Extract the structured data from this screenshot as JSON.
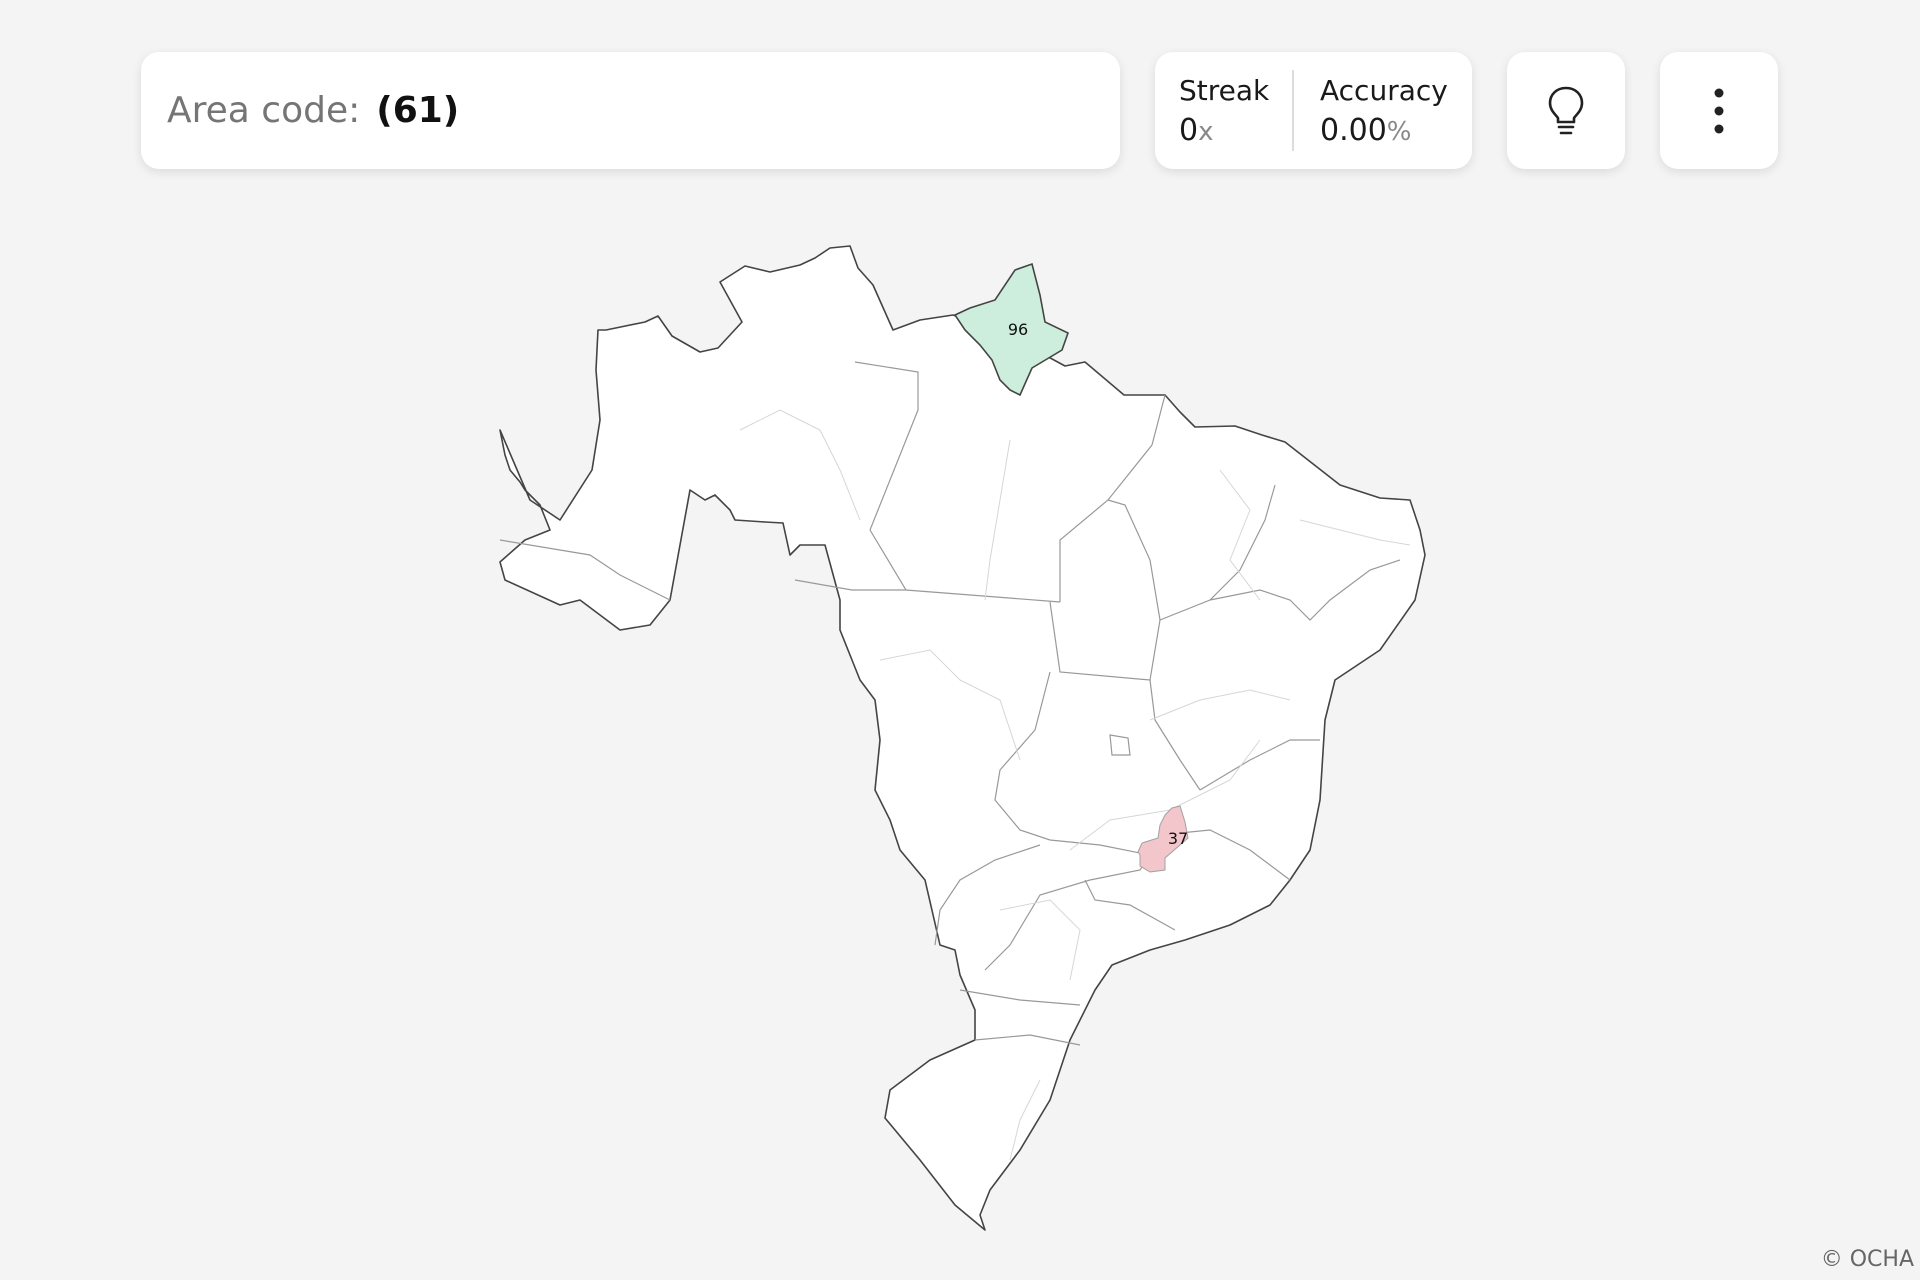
{
  "prompt": {
    "label": "Area code:",
    "value": "(61)"
  },
  "stats": {
    "streak_label": "Streak",
    "streak_value": "0",
    "streak_unit": "x",
    "accuracy_label": "Accuracy",
    "accuracy_value": "0.00",
    "accuracy_unit": "%"
  },
  "buttons": {
    "hint_icon": "lightbulb-icon",
    "menu_icon": "more-vertical-icon"
  },
  "map": {
    "correct_region": {
      "code": "96",
      "color": "#cdeedd"
    },
    "wrong_region": {
      "code": "37",
      "color": "#f3c6cc"
    }
  },
  "footer": {
    "copyright": "© OCHA"
  }
}
